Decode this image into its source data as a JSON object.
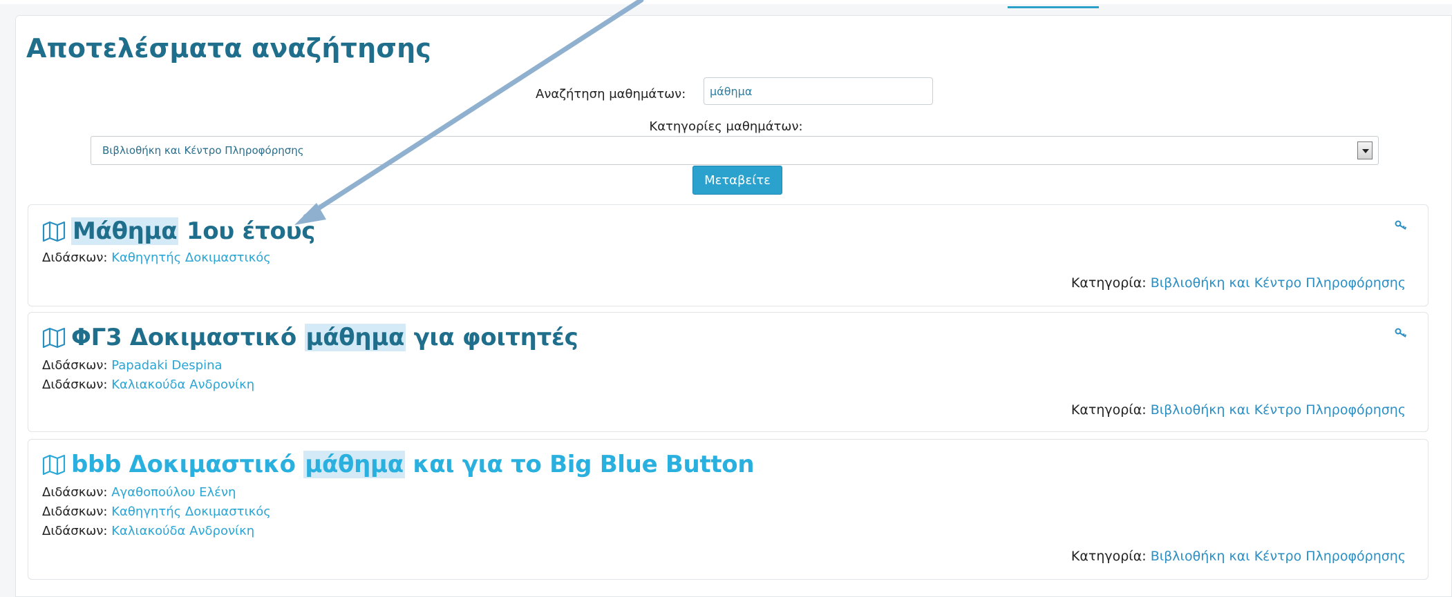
{
  "page": {
    "title": "Αποτελέσματα αναζήτησης"
  },
  "search": {
    "label": "Αναζήτηση μαθημάτων:",
    "value": "μάθημα",
    "category_label": "Κατηγορίες μαθημάτων:",
    "category_selected": "Βιβλιοθήκη και Κέντρο Πληροφόρησης",
    "submit_label": "Μεταβείτε"
  },
  "courses": [
    {
      "icon": "map-icon",
      "title_highlight": "Μάθημα",
      "title_rest": " 1ου έτους",
      "has_key_icon": true,
      "teacher_label": "Διδάσκων:",
      "teachers": [
        "Καθηγητής Δοκιμαστικός"
      ],
      "category_label": "Κατηγορία:",
      "category": "Βιβλιοθήκη και Κέντρο Πληροφόρησης"
    },
    {
      "icon": "map-icon",
      "title_before": "ΦΓ3 Δοκιμαστικό ",
      "title_highlight": "μάθημα",
      "title_rest": " για φοιτητές",
      "has_key_icon": true,
      "teacher_label": "Διδάσκων:",
      "teachers": [
        "Papadaki Despina",
        "Καλιακούδα Ανδρονίκη"
      ],
      "category_label": "Κατηγορία:",
      "category": "Βιβλιοθήκη και Κέντρο Πληροφόρησης"
    },
    {
      "icon": "map-icon",
      "title_before": "bbb Δοκιμαστικό ",
      "title_highlight": "μάθημα",
      "title_rest": " και για το Big Blue Button",
      "has_key_icon": false,
      "teacher_label": "Διδάσκων:",
      "teachers": [
        "Αγαθοπούλου Ελένη",
        "Καθηγητής Δοκιμαστικός",
        "Καλιακούδα Ανδρονίκη"
      ],
      "category_label": "Κατηγορία:",
      "category": "Βιβλιοθήκη και Κέντρο Πληροφόρησης"
    }
  ],
  "colors": {
    "title": "#1e6e8c",
    "link": "#2aa5d4",
    "button": "#2ba2ce",
    "highlight": "#d4eaf6",
    "annotation_arrow": "#8fb0cf"
  }
}
